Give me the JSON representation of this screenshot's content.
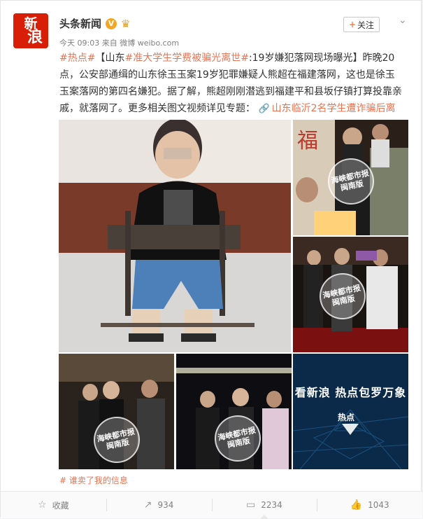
{
  "author": {
    "logo_line1": "新",
    "logo_line2": "浪",
    "name": "头条新闻",
    "verified_mark": "V",
    "member_icon": "crown-icon"
  },
  "meta": {
    "time": "今天 09:03",
    "source_prefix": "来自",
    "source": "微博 weibo.com"
  },
  "follow": {
    "plus": "+",
    "label": "关注"
  },
  "post": {
    "tag1": "#热点#",
    "bracket_open": "【山东",
    "tag2": "#准大学生学费被骗光离世#",
    "headline": ":19岁嫌犯落网现场曝光】",
    "body": "昨晚20点，公安部通缉的山东徐玉玉案19岁犯罪嫌疑人熊超在福建落网，这也是徐玉玉案落网的第四名嫌犯。据了解，熊超刚刚潜逃到福建平和县坂仔镇打算投靠亲戚，就落网了。更多相关图文视频详见专题：",
    "topic_link": "山东临沂2名学生遭诈骗后离世"
  },
  "images": {
    "watermark": "海峡都市报",
    "watermark_sub": "闽南版",
    "promo_title": "看新浪 热点包罗万象",
    "promo_logo": "热点"
  },
  "tagline": "谁卖了我的信息",
  "actions": {
    "favorite": "收藏",
    "repost": "934",
    "comment": "2234",
    "like": "1043"
  }
}
